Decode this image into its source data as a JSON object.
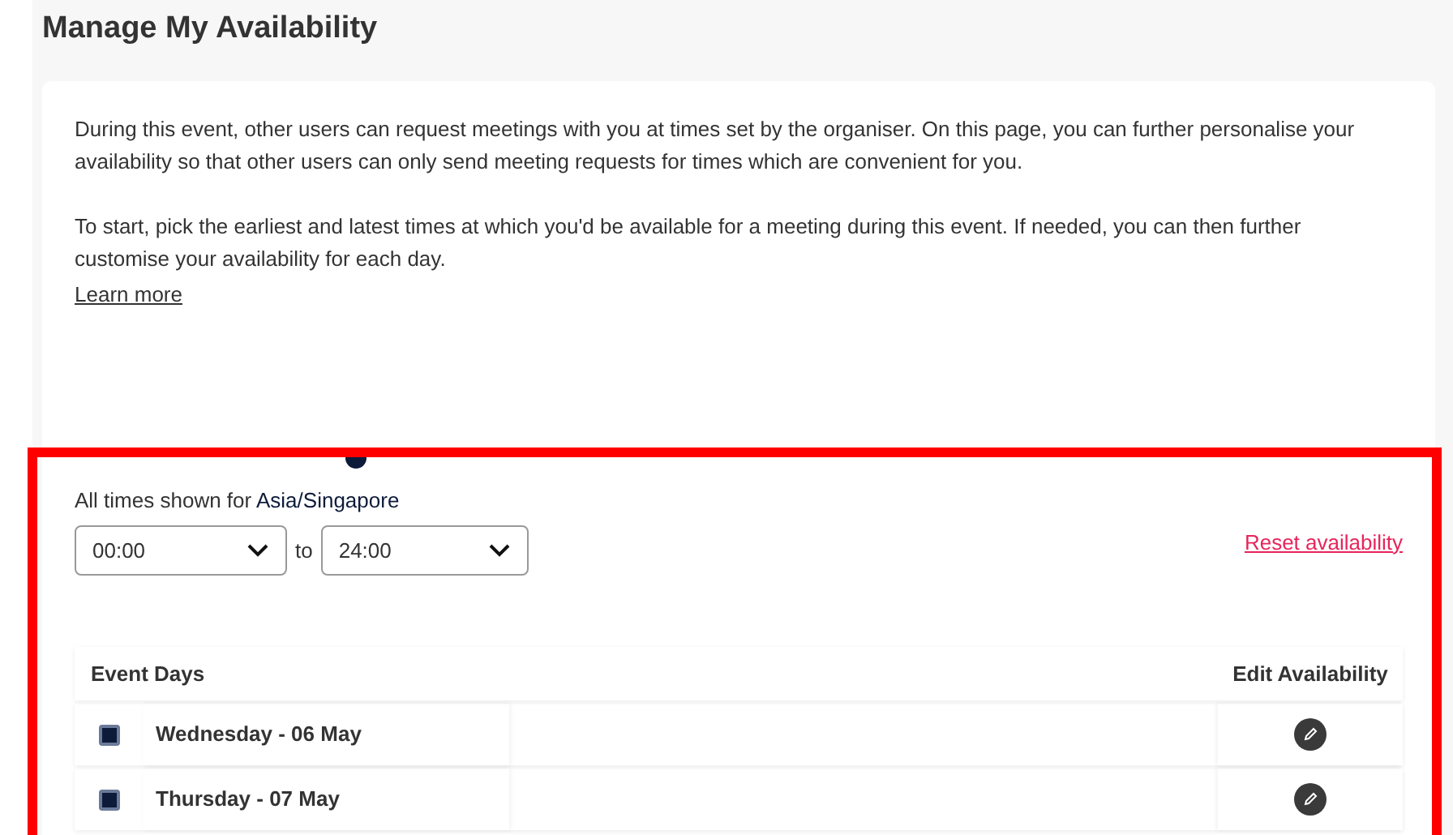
{
  "title": "Manage My Availability",
  "intro": [
    "During this event, other users can request meetings with you at times set by the organiser. On this page, you can further personalise your availability so that other users can only send meeting requests for times which are convenient for you.",
    "To start, pick the earliest and latest times at which you'd be available for a meeting during this event. If needed, you can then further customise your availability for each day."
  ],
  "learn_more": "Learn more",
  "timezone_prefix": "All times shown for",
  "timezone": "Asia/Singapore",
  "from": "00:00",
  "to_label": "to",
  "to": "24:00",
  "reset": "Reset availability",
  "table": {
    "columns": [
      "Event Days",
      "Edit Availability"
    ],
    "rows": [
      {
        "day": "Wednesday - 06 May",
        "checked": true
      },
      {
        "day": "Thursday - 07 May",
        "checked": true
      }
    ]
  }
}
